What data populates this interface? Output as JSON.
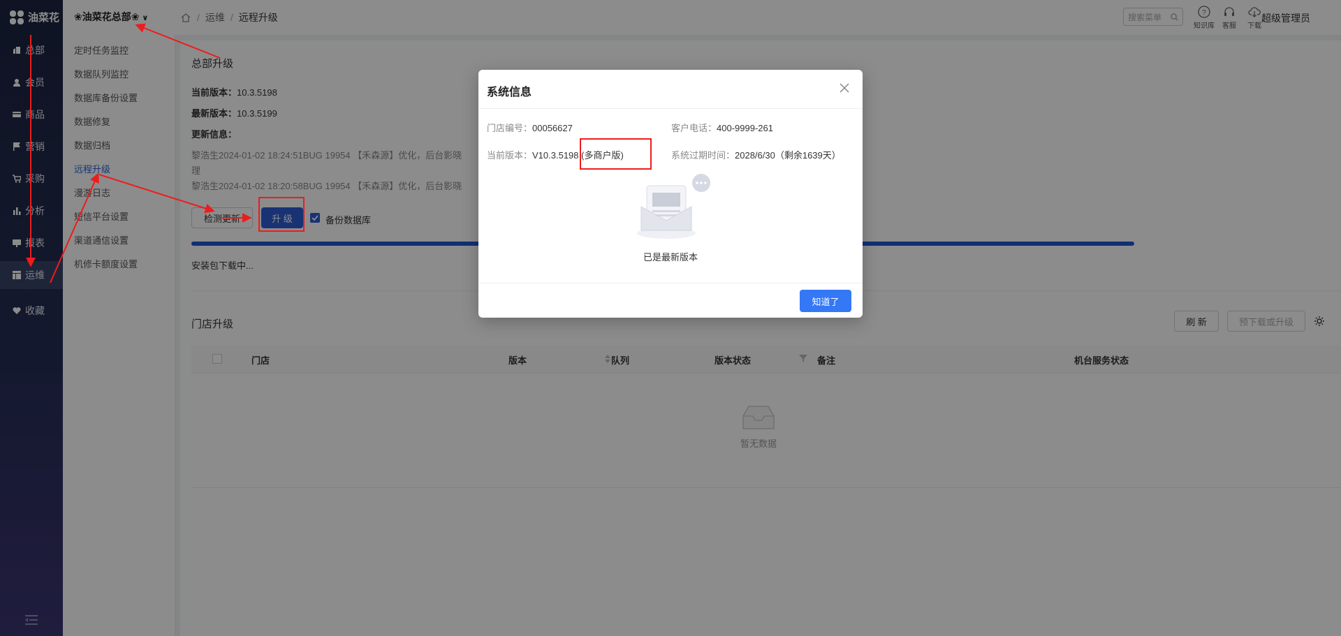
{
  "sidebar": {
    "brand": "油菜花",
    "items": [
      {
        "label": "总部",
        "icon": "building-icon"
      },
      {
        "label": "会员",
        "icon": "user-icon"
      },
      {
        "label": "商品",
        "icon": "card-icon"
      },
      {
        "label": "营销",
        "icon": "flag-icon"
      },
      {
        "label": "采购",
        "icon": "cart-icon"
      },
      {
        "label": "分析",
        "icon": "bar-chart-icon"
      },
      {
        "label": "报表",
        "icon": "report-icon"
      },
      {
        "label": "运维",
        "icon": "layout-icon"
      },
      {
        "label": "收藏",
        "icon": "heart-icon"
      }
    ],
    "active_index": 7
  },
  "submenu": {
    "store_title": "❀油菜花总部❀",
    "items": [
      "定时任务监控",
      "数据队列监控",
      "数据库备份设置",
      "数据修复",
      "数据归档",
      "远程升级",
      "漫游日志",
      "短信平台设置",
      "渠道通信设置",
      "机修卡额度设置"
    ],
    "active_index": 5
  },
  "topbar": {
    "breadcrumb": [
      "运维",
      "远程升级"
    ],
    "search_placeholder": "搜索菜单",
    "tools": [
      {
        "label": "知识库",
        "icon": "help-circle-icon"
      },
      {
        "label": "客服",
        "icon": "headset-icon"
      },
      {
        "label": "下载",
        "icon": "cloud-download-icon"
      }
    ],
    "user": "超级管理员"
  },
  "hq": {
    "title": "总部升级",
    "current_label": "当前版本：",
    "current_value": "10.3.5198",
    "latest_label": "最新版本：",
    "latest_value": "10.3.5199",
    "update_label": "更新信息：",
    "log1": "黎浩生2024-01-02 18:24:51BUG 19954 【禾森源】优化，后台影晓",
    "log1_wrap": "理",
    "log2": "黎浩生2024-01-02 18:20:58BUG 19954 【禾森源】优化，后台影晓",
    "check_button": "检测更新",
    "upgrade_button": "升 级",
    "backup_label": "备份数据库",
    "backup_checked": true,
    "download_status": "安装包下载中..."
  },
  "store": {
    "title": "门店升级",
    "refresh_button": "刷 新",
    "predownload_button": "预下载或升级",
    "columns": [
      "门店",
      "版本",
      "队列",
      "版本状态",
      "备注",
      "机台服务状态"
    ],
    "empty_text": "暂无数据"
  },
  "modal": {
    "title": "系统信息",
    "store_no_label": "门店编号：",
    "store_no": "00056627",
    "phone_label": "客户电话：",
    "phone": "400-9999-261",
    "version_label": "当前版本：",
    "version": "V10.3.5198",
    "edition": "(多商户版)",
    "expire_label": "系统过期时间：",
    "expire": "2028/6/30（剩余1639天）",
    "status": "已是最新版本",
    "ok_button": "知道了"
  },
  "colors": {
    "primary": "#3478f6",
    "annotation": "#ee1c1c",
    "sidebar_top": "#1c2440",
    "progress": "#1f56d6"
  }
}
